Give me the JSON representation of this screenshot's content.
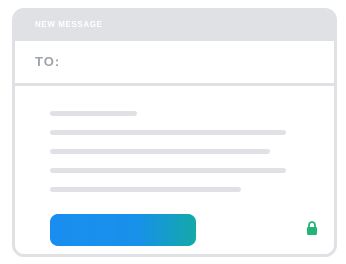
{
  "window": {
    "title": "NEW MESSAGE"
  },
  "recipient": {
    "label": "TO:"
  },
  "message_body": {
    "placeholder_lines": 5
  },
  "send_button": {
    "label": "",
    "gradient_colors": [
      "#1a8ef0",
      "#13a9a8"
    ]
  },
  "icons": {
    "lock": "lock-icon"
  },
  "colors": {
    "chrome": "#dfe1e5",
    "label_text": "#9ea3aa",
    "lock": "#22b573"
  }
}
